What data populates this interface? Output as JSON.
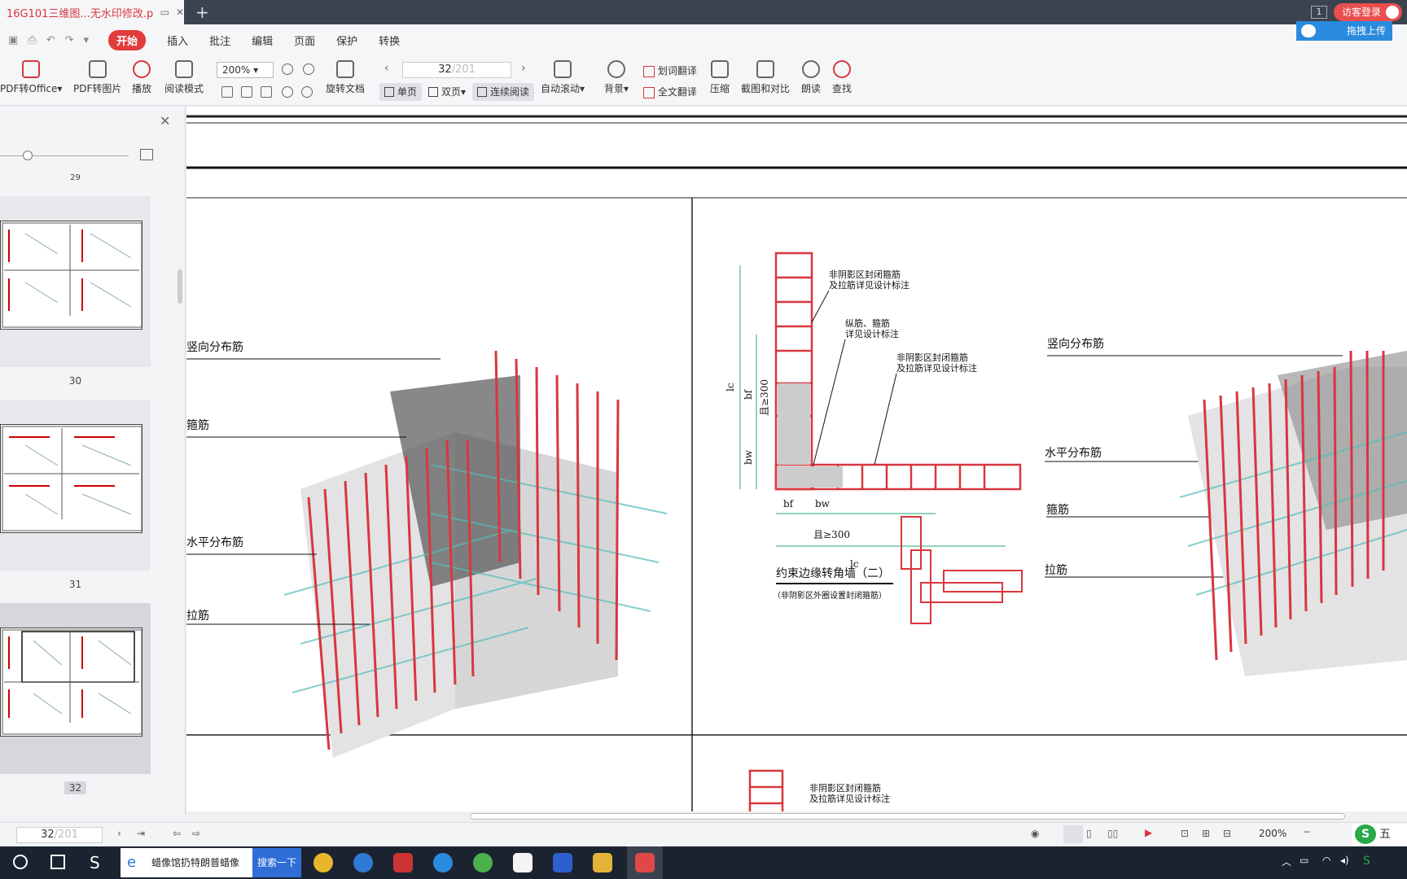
{
  "tab": {
    "title": "16G101三维图...无水印修改.pdf"
  },
  "titlebar": {
    "badge": "1",
    "visitor": "访客登录",
    "upload": "拖拽上传"
  },
  "menu": {
    "items": [
      "开始",
      "插入",
      "批注",
      "编辑",
      "页面",
      "保护",
      "转换"
    ]
  },
  "ribbon": {
    "pdf_to_office": "PDF转Office",
    "pdf_to_image": "PDF转图片",
    "play": "播放",
    "read_mode": "阅读模式",
    "zoom": "200%",
    "rotate": "旋转文档",
    "page_current": "32",
    "page_total": "/201",
    "single": "单页",
    "double": "双页",
    "continuous": "连续阅读",
    "auto_scroll": "自动滚动",
    "background": "背景",
    "word_translate": "划词翻译",
    "full_translate": "全文翻译",
    "compress": "压缩",
    "screenshot_compare": "截图和对比",
    "read_aloud": "朗读",
    "find": "查找"
  },
  "sidebar": {
    "pages": [
      "29",
      "30",
      "31",
      "32"
    ]
  },
  "drawing": {
    "left_labels": [
      "竖向分布筋",
      "箍筋",
      "水平分布筋",
      "拉筋"
    ],
    "right_labels": [
      "竖向分布筋",
      "水平分布筋",
      "箍筋",
      "拉筋"
    ],
    "note1": "非阴影区封闭箍筋",
    "note1b": "及拉筋详见设计标注",
    "note2": "纵筋、箍筋",
    "note2b": "详见设计标注",
    "note3": "非阴影区封闭箍筋",
    "note3b": "及拉筋详见设计标注",
    "dim_lc": "lc",
    "dim_bf": "bf",
    "dim_bw": "bw",
    "dim_300": "且≥300",
    "caption": "约束边缘转角墙（二）",
    "sub_caption": "（非阴影区外圈设置封闭箍筋）",
    "note4": "非阴影区封闭箍筋",
    "note4b": "及拉筋详见设计标注"
  },
  "status": {
    "page_current": "32",
    "page_total": "/201",
    "zoom": "200%"
  },
  "taskbar": {
    "search_text": "蜡像馆扔特朗普蜡像",
    "search_button": "搜索一下"
  },
  "ime": {
    "label": "五"
  }
}
